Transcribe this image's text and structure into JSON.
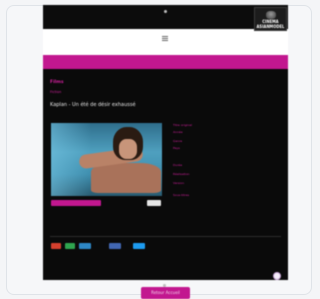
{
  "logo": {
    "line1": "CINEMA",
    "line2": "ASIANMODEL"
  },
  "main": {
    "category": "Films",
    "subcategory": "Fiction",
    "title": "Kaplan - Un été de désir exhaussé"
  },
  "details": [
    {
      "k": "Titre original",
      "v": ""
    },
    {
      "k": "Année",
      "v": ""
    },
    {
      "k": "Genre",
      "v": ""
    },
    {
      "k": "Pays",
      "v": ""
    },
    {
      "k": "Durée",
      "v": ""
    },
    {
      "k": "Réalisation",
      "v": ""
    },
    {
      "k": "Version",
      "v": ""
    },
    {
      "k": "Sous-titres",
      "v": ""
    }
  ],
  "colors": {
    "accent": "#c2178f",
    "dark": "#0a0a0a"
  },
  "social": [
    "red",
    "green",
    "blue",
    "blue2",
    "blue3"
  ],
  "cta_label": "Retour Accueil"
}
